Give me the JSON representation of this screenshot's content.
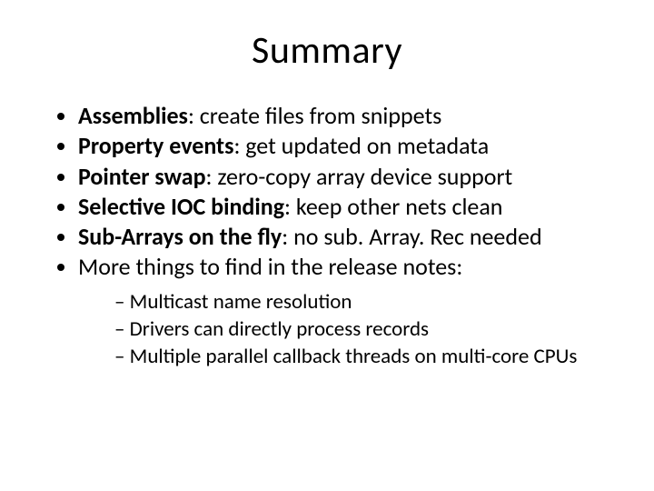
{
  "title": "Summary",
  "items": [
    {
      "bold": "Assemblies",
      "rest": ": create files from snippets"
    },
    {
      "bold": "Property events",
      "rest": ": get updated on metadata"
    },
    {
      "bold": "Pointer swap",
      "rest": ": zero-copy array device support"
    },
    {
      "bold": "Selective IOC binding",
      "rest": ": keep other nets clean"
    },
    {
      "bold": "Sub-Arrays on the fly",
      "rest": ": no sub. Array. Rec needed"
    },
    {
      "bold": "",
      "rest": "More things to find in the release notes:"
    }
  ],
  "subitems": [
    "Multicast name resolution",
    "Drivers can directly process records",
    "Multiple parallel callback threads on multi-core CPUs"
  ]
}
